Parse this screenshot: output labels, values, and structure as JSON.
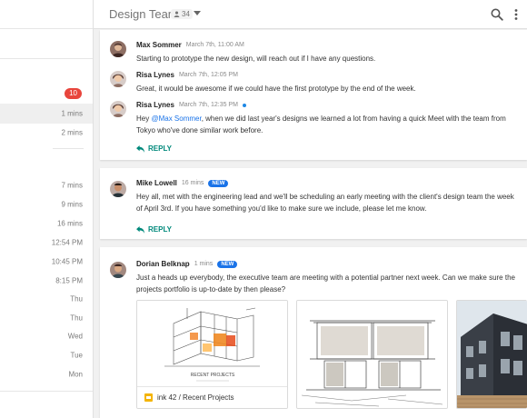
{
  "header": {
    "title": "Design Team",
    "member_count": "34"
  },
  "sidebar": {
    "badge": "10",
    "times": [
      "1 mins",
      "2 mins",
      "7 mins",
      "9 mins",
      "16 mins",
      "12:54 PM",
      "10:45 PM",
      "8:15 PM",
      "Thu",
      "Thu",
      "Wed",
      "Tue",
      "Mon"
    ]
  },
  "threads": [
    {
      "messages": [
        {
          "name": "Max Sommer",
          "time": "March 7th, 11:00 AM",
          "text": "Starting to prototype the new design, will reach out if I have any questions."
        },
        {
          "name": "Risa Lynes",
          "time": "March 7th, 12:05 PM",
          "text": "Great, it would be awesome if we could have the first prototype by the end of the week."
        },
        {
          "name": "Risa Lynes",
          "time": "March 7th, 12:35 PM",
          "text_pre": "Hey ",
          "mention": "@Max Sommer",
          "text_post": ", when we did last year's designs we learned a lot from having a quick Meet with the team from Tokyo who've done similar work before."
        }
      ],
      "reply_label": "REPLY"
    },
    {
      "messages": [
        {
          "name": "Mike Lowell",
          "time": "16 mins",
          "badge": "NEW",
          "text": "Hey all, met with the engineering lead and we'll be scheduling an early meeting with the client's design team the week of April 3rd. If you have something you'd like to make sure we include, please let me know."
        }
      ],
      "reply_label": "REPLY"
    },
    {
      "messages": [
        {
          "name": "Dorian Belknap",
          "time": "1 mins",
          "badge": "NEW",
          "text": "Just a heads up everybody, the executive team are meeting with a potential partner next week. Can we make sure the projects portfolio is up-to-date by then please?"
        }
      ],
      "attachments": [
        {
          "caption": "ink 42 / Recent Projects",
          "image_label": "RECENT PROJECTS"
        }
      ]
    }
  ],
  "colors": {
    "accent": "#00897b",
    "badge_red": "#e8453c",
    "new_blue": "#1a73e8"
  }
}
